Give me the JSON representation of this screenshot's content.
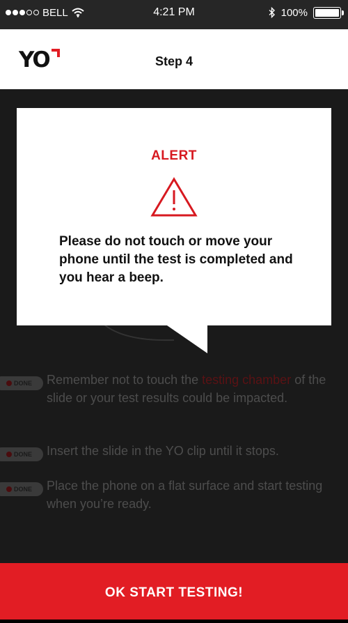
{
  "status_bar": {
    "carrier": "BELL",
    "time": "4:21 PM",
    "battery": "100%",
    "battery_level": 1.0,
    "signal_bars_filled": 3,
    "signal_bars_total": 5
  },
  "header": {
    "logo_text": "YO",
    "title": "Step 4"
  },
  "alert": {
    "title": "ALERT",
    "message": "Please do not touch or move your phone until the test is completed and you hear a beep."
  },
  "steps": [
    {
      "badge": "DONE",
      "text_before": "Remember not to touch the ",
      "highlight": "testing chamber",
      "text_after": " of the slide or your test results could be impacted."
    },
    {
      "badge": "DONE",
      "text": "Insert the slide in the YO clip until it stops."
    },
    {
      "badge": "DONE",
      "text": "Place the phone on a flat surface and start testing when you’re ready."
    }
  ],
  "cta": {
    "label": "OK START TESTING!"
  },
  "colors": {
    "accent": "#e21d24",
    "alert_title": "#d71920",
    "status_bar_bg": "#262626",
    "overlay_bg": "#1a1a1a"
  },
  "icons": {
    "wifi": "wifi-icon",
    "bluetooth": "bluetooth-icon",
    "battery": "battery-icon",
    "warning": "warning-triangle-icon"
  }
}
